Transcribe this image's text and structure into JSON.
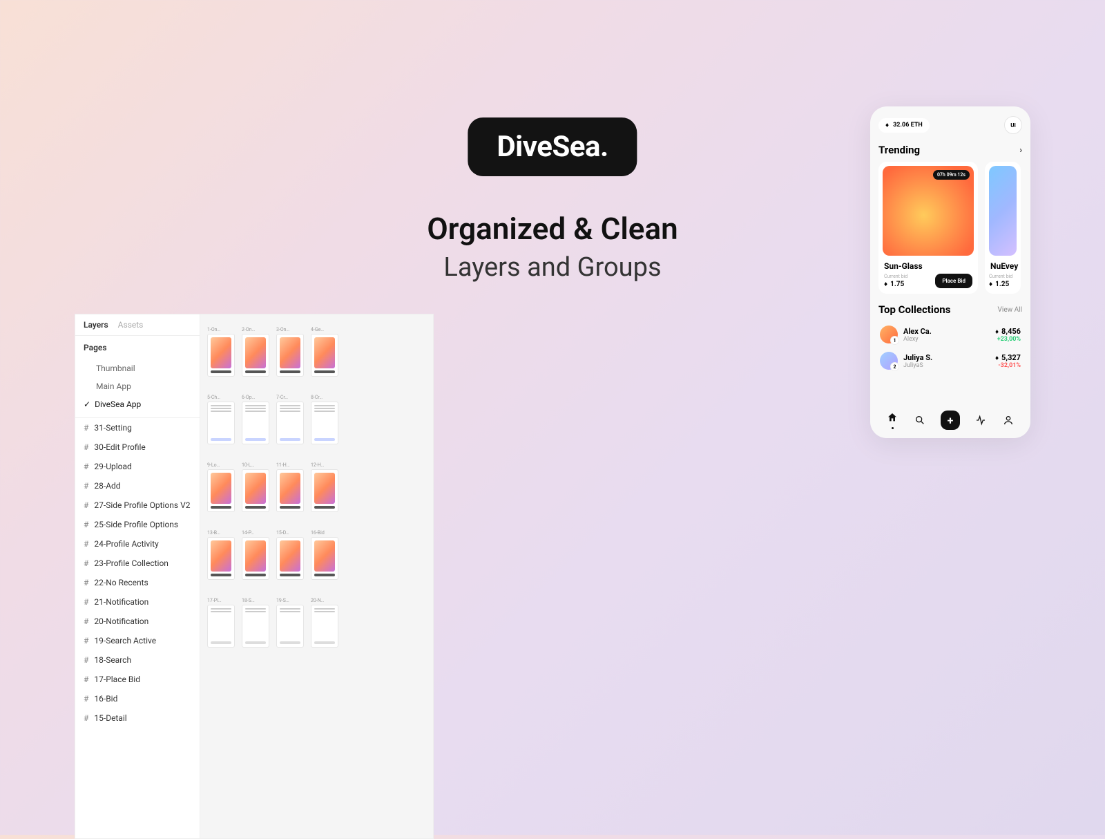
{
  "logo": "DiveSea.",
  "hero": {
    "title": "Organized & Clean",
    "subtitle": "Layers and Groups"
  },
  "figma": {
    "tabs": {
      "layers": "Layers",
      "assets": "Assets",
      "project": "DiveSea App"
    },
    "pages_header": "Pages",
    "pages": [
      "Thumbnail",
      "Main App",
      "DiveSea App"
    ],
    "active_page_index": 2,
    "frames": [
      "31-Setting",
      "30-Edit Profile",
      "29-Upload",
      "28-Add",
      "27-Side Profile Options V2",
      "25-Side Profile Options",
      "24-Profile Activity",
      "23-Profile Collection",
      "22-No Recents",
      "21-Notification",
      "20-Notification",
      "19-Search Active",
      "18-Search",
      "17-Place Bid",
      "16-Bid",
      "15-Detail"
    ],
    "canvas_rows": [
      [
        "1-On…",
        "2-On…",
        "3-On…",
        "4-Ge…"
      ],
      [
        "5-Ch…",
        "6-Op…",
        "7-Cr…",
        "8-Cr…"
      ],
      [
        "9-Lo…",
        "10-L…",
        "11-H…",
        "12-H…"
      ],
      [
        "13-B…",
        "14-P…",
        "15-D…",
        "16-Bid"
      ],
      [
        "17-Pl…",
        "18-S…",
        "19-S…",
        "20-N…"
      ]
    ]
  },
  "phone": {
    "balance": "32.06 ETH",
    "avatar_initials": "UI",
    "trending": {
      "title": "Trending",
      "timer": "07h 09m 12s",
      "cards": [
        {
          "name": "Sun-Glass",
          "bid_label": "Current bid",
          "bid_value": "1.75",
          "button": "Place Bid"
        },
        {
          "name": "NuEvey",
          "bid_label": "Current bid",
          "bid_value": "1.25"
        }
      ]
    },
    "collections": {
      "title": "Top Collections",
      "viewall": "View All",
      "items": [
        {
          "rank": "1",
          "name": "Alex Ca.",
          "user": "Alexy",
          "amount": "8,456",
          "change": "+23,00%",
          "dir": "up"
        },
        {
          "rank": "2",
          "name": "Juliya S.",
          "user": "JuliyaS",
          "amount": "5,327",
          "change": "-32,01%",
          "dir": "down"
        }
      ]
    }
  }
}
